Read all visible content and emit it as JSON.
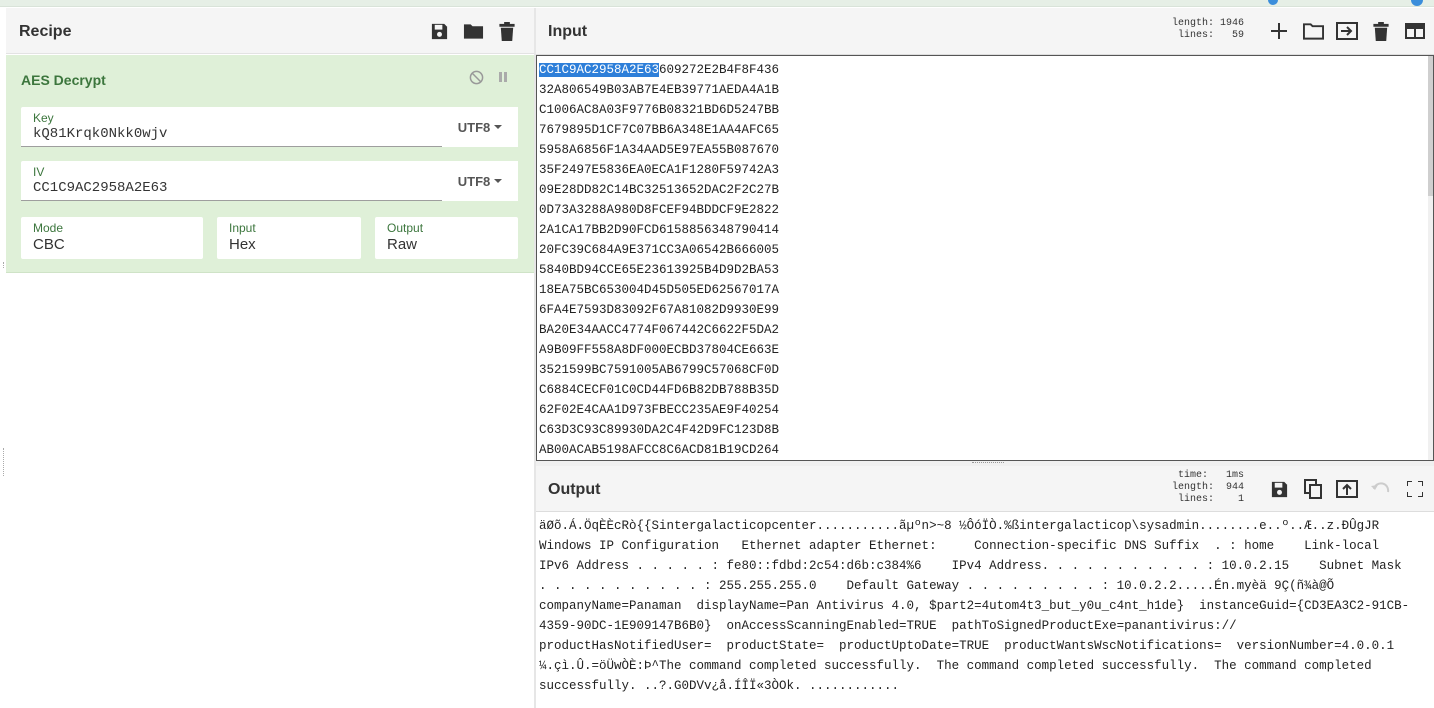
{
  "recipe": {
    "title": "Recipe",
    "icons": [
      "save-icon",
      "folder-icon",
      "trash-icon"
    ],
    "operation": {
      "name": "AES Decrypt",
      "key": {
        "label": "Key",
        "value": "kQ81Krqk0Nkk0wjv",
        "encoding": "UTF8"
      },
      "iv": {
        "label": "IV",
        "value": "CC1C9AC2958A2E63",
        "encoding": "UTF8"
      },
      "mode": {
        "label": "Mode",
        "value": "CBC"
      },
      "input": {
        "label": "Input",
        "value": "Hex"
      },
      "output": {
        "label": "Output",
        "value": "Raw"
      }
    }
  },
  "input": {
    "title": "Input",
    "stats": {
      "length_label": "length:",
      "length": "1946",
      "lines_label": "lines:",
      "lines": "59"
    },
    "selected": "CC1C9AC2958A2E63",
    "first_rest": "609272E2B4F8F436",
    "lines": [
      "32A806549B03AB7E4EB39771AEDA4A1B",
      "C1006AC8A03F9776B08321BD6D5247BB",
      "7679895D1CF7C07BB6A348E1AA4AFC65",
      "5958A6856F1A34AAD5E97EA55B087670",
      "35F2497E5836EA0ECA1F1280F59742A3",
      "09E28DD82C14BC32513652DAC2F2C27B",
      "0D73A3288A980D8FCEF94BDDCF9E2822",
      "2A1CA17BB2D90FCD6158856348790414",
      "20FC39C684A9E371CC3A06542B666005",
      "5840BD94CCE65E23613925B4D9D2BA53",
      "18EA75BC653004D45D505ED62567017A",
      "6FA4E7593D83092F67A81082D9930E99",
      "BA20E34AACC4774F067442C6622F5DA2",
      "A9B09FF558A8DF000ECBD37804CE663E",
      "3521599BC7591005AB6799C57068CF0D",
      "C6884CECF01C0CD44FD6B82DB788B35D",
      "62F02E4CAA1D973FBECC235AE9F40254",
      "C63D3C93C89930DA2C4F42D9FC123D8B",
      "AB00ACAB5198AFCC8C6ACD81B19CD264"
    ]
  },
  "output": {
    "title": "Output",
    "stats": {
      "time_label": "time:",
      "time": "1ms",
      "length_label": "length:",
      "length": "944",
      "lines_label": "lines:",
      "lines": "1"
    },
    "lines": [
      "äØõ.Á.ÖqÈÈcRò{{Sintergalacticopcenter...........ãµºn>~8 ½ÔóÏÒ.%ßintergalacticop\\sysadmin........e..º..Æ..z.ÐÛgJR",
      "Windows IP Configuration   Ethernet adapter Ethernet:     Connection-specific DNS Suffix  . : home    Link-local",
      "IPv6 Address . . . . . : fe80::fdbd:2c54:d6b:c384%6    IPv4 Address. . . . . . . . . . . : 10.0.2.15    Subnet Mask",
      ". . . . . . . . . . . : 255.255.255.0    Default Gateway . . . . . . . . . : 10.0.2.2.....Én.myèä 9Ç(ñ¾à@Õ",
      "companyName=Panaman  displayName=Pan Antivirus 4.0, $part2=4utom4t3_but_y0u_c4nt_h1de}  instanceGuid={CD3EA3C2-91CB-",
      "4359-90DC-1E909147B6B0}  onAccessScanningEnabled=TRUE  pathToSignedProductExe=panantivirus://",
      "productHasNotifiedUser=  productState=  productUptoDate=TRUE  productWantsWscNotifications=  versionNumber=4.0.0.1",
      "¼.çì.Û.=öÜwÒÈ:Þ^The command completed successfully.  The command completed successfully.  The command completed",
      "successfully. ..?.G0DVv¿å.ÍÎÏ«3ÒOk. ............"
    ]
  }
}
